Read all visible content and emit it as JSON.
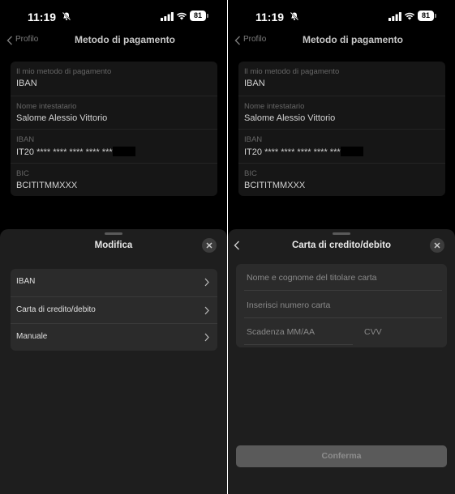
{
  "status_bar": {
    "time": "11:19",
    "battery": "81"
  },
  "left": {
    "nav": {
      "back_label": "Profilo",
      "title": "Metodo di pagamento"
    },
    "info": [
      {
        "label": "Il mio metodo di pagamento",
        "value": "IBAN"
      },
      {
        "label": "Nome intestatario",
        "value": "Salome Alessio Vittorio"
      },
      {
        "label": "IBAN",
        "value": "IT20 **** **** **** **** ***"
      },
      {
        "label": "BIC",
        "value": "BCITITMMXXX"
      }
    ],
    "sheet": {
      "title": "Modifica",
      "options": [
        "IBAN",
        "Carta di credito/debito",
        "Manuale"
      ]
    }
  },
  "right": {
    "nav": {
      "back_label": "Profilo",
      "title": "Metodo di pagamento"
    },
    "info": [
      {
        "label": "Il mio metodo di pagamento",
        "value": "IBAN"
      },
      {
        "label": "Nome intestatario",
        "value": "Salome Alessio Vittorio"
      },
      {
        "label": "IBAN",
        "value": "IT20 **** **** **** **** ***"
      },
      {
        "label": "BIC",
        "value": "BCITITMMXXX"
      }
    ],
    "sheet": {
      "title": "Carta di credito/debito",
      "fields": {
        "cardholder_placeholder": "Nome e cognome del titolare carta",
        "card_number_placeholder": "Inserisci numero carta",
        "expiry_placeholder": "Scadenza MM/AA",
        "cvv_placeholder": "CVV"
      },
      "confirm_label": "Conferma"
    }
  }
}
